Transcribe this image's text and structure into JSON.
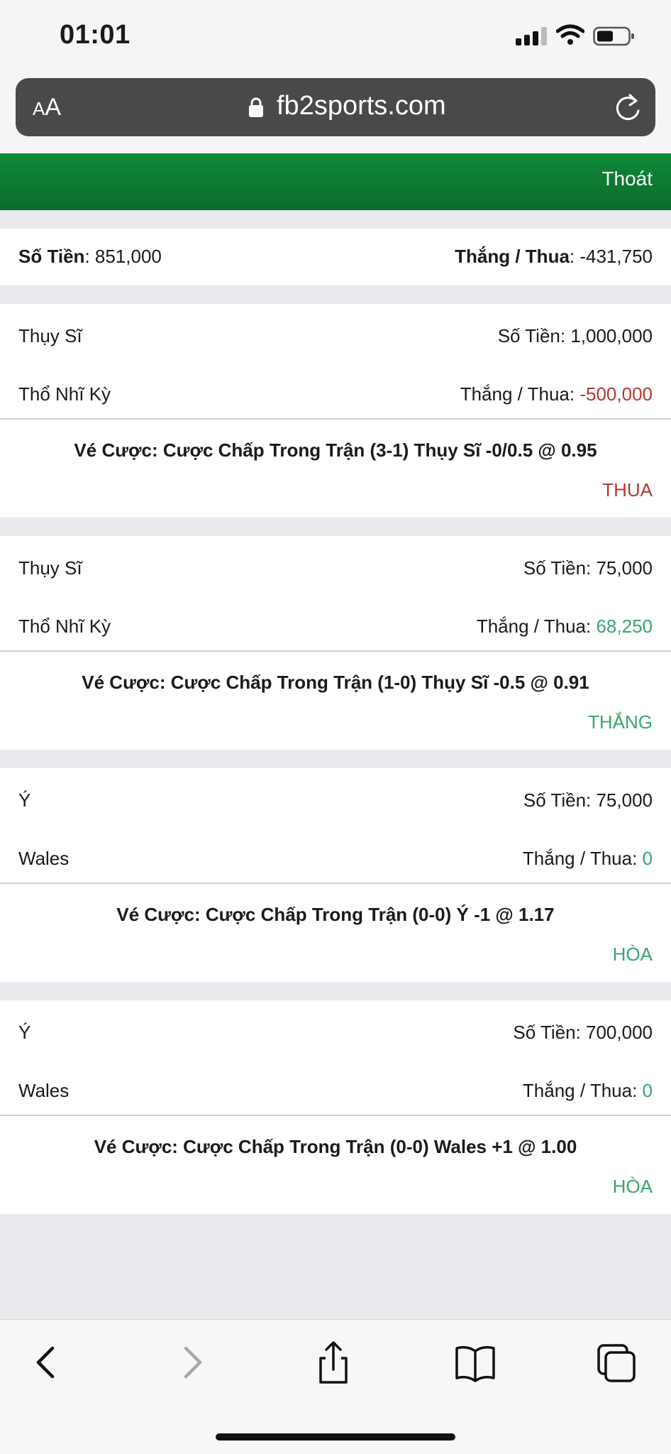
{
  "status_bar": {
    "time": "01:01"
  },
  "browser": {
    "aa_label_small": "A",
    "aa_label_large": "A",
    "url": "fb2sports.com"
  },
  "header": {
    "logout_label": "Thoát"
  },
  "summary": {
    "amount_label": "Số Tiền",
    "amount_value": ": 851,000",
    "winloss_label": "Thắng / Thua",
    "winloss_value": ": -431,750"
  },
  "bets": [
    {
      "team1": "Thụy Sĩ",
      "team2": "Thổ Nhĩ Kỳ",
      "amount": "Số Tiền: 1,000,000",
      "winloss_label": "Thắng / Thua: ",
      "winloss_value": "-500,000",
      "ticket": "Vé Cược: Cược Chấp Trong Trận (3-1) Thụy Sĩ -0/0.5 @ 0.95",
      "result": "THUA"
    },
    {
      "team1": "Thụy Sĩ",
      "team2": "Thổ Nhĩ Kỳ",
      "amount": "Số Tiền: 75,000",
      "winloss_label": "Thắng / Thua: ",
      "winloss_value": "68,250",
      "ticket": "Vé Cược: Cược Chấp Trong Trận (1-0) Thụy Sĩ -0.5 @ 0.91",
      "result": "THẮNG"
    },
    {
      "team1": "Ý",
      "team2": "Wales",
      "amount": "Số Tiền: 75,000",
      "winloss_label": "Thắng / Thua: ",
      "winloss_value": "0",
      "ticket": "Vé Cược: Cược Chấp Trong Trận (0-0) Ý -1 @ 1.17",
      "result": "HÒA"
    },
    {
      "team1": "Ý",
      "team2": "Wales",
      "amount": "Số Tiền: 700,000",
      "winloss_label": "Thắng / Thua: ",
      "winloss_value": "0",
      "ticket": "Vé Cược: Cược Chấp Trong Trận (0-0) Wales +1 @ 1.00",
      "result": "HÒA"
    }
  ],
  "colors": {
    "header_green": "#0f7d34",
    "loss_red": "#b03a2e",
    "win_green": "#3aa56c"
  }
}
